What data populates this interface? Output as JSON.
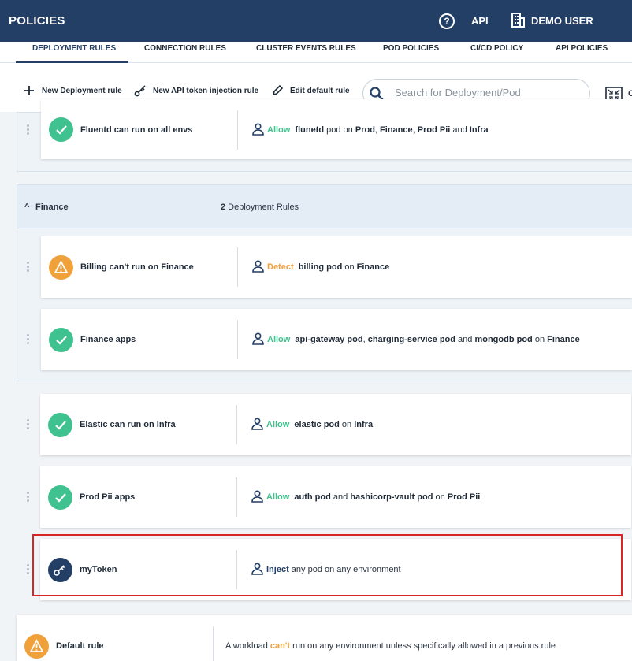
{
  "header": {
    "title": "POLICIES",
    "help_label": "?",
    "api_label": "API",
    "user_label": "DEMO USER"
  },
  "tabs": [
    {
      "label": "DEPLOYMENT RULES",
      "active": true
    },
    {
      "label": "CONNECTION RULES",
      "active": false
    },
    {
      "label": "CLUSTER EVENTS RULES",
      "active": false
    },
    {
      "label": "POD POLICIES",
      "active": false
    },
    {
      "label": "CI/CD POLICY",
      "active": false
    },
    {
      "label": "API POLICIES",
      "active": false
    }
  ],
  "toolbar": {
    "new_deployment_rule": "New Deployment rule",
    "new_api_token_rule": "New API token injection rule",
    "edit_default_rule": "Edit default rule",
    "search_placeholder": "Search for Deployment/Pod",
    "truncated_label": "C"
  },
  "groups": {
    "finance": {
      "name": "Finance",
      "count": "2",
      "count_suffix": " Deployment Rules"
    }
  },
  "rules": {
    "fluentd": {
      "name": "Fluentd can run on all envs",
      "action": "Allow",
      "pod": "flunetd",
      "pod_word": " pod",
      "on": " on ",
      "env1": "Prod",
      "sep1": ", ",
      "env2": "Finance",
      "sep2": ", ",
      "env3": "Prod Pii",
      "and": " and ",
      "env4": "Infra"
    },
    "billing": {
      "name": "Billing can't run on Finance",
      "action": "Detect",
      "pod": "billing",
      "pod_word": " pod",
      "on": " on ",
      "env1": "Finance"
    },
    "finance_apps": {
      "name": "Finance apps",
      "action": "Allow",
      "pod1": "api-gateway pod",
      "sep1": ", ",
      "pod2": "charging-service pod",
      "and": " and ",
      "pod3": "mongodb pod",
      "on": " on ",
      "env1": "Finance"
    },
    "elastic": {
      "name": "Elastic can run on Infra",
      "action": "Allow",
      "pod": "elastic",
      "pod_word": " pod",
      "on": " on ",
      "env1": "Infra"
    },
    "prodpii": {
      "name": "Prod Pii apps",
      "action": "Allow",
      "pod1": "auth pod",
      "and": " and ",
      "pod2": "hashicorp-vault pod",
      "on": " on ",
      "env1": "Prod Pii"
    },
    "mytoken": {
      "name": "myToken",
      "action": "Inject",
      "rest": " any pod on any environment"
    },
    "default": {
      "name": "Default rule",
      "pre": "A workload ",
      "cant": "can't",
      "post": " run on any environment unless specifically allowed in a previous rule"
    }
  },
  "colors": {
    "header_bg": "#243f66",
    "allow": "#3fc28f",
    "detect": "#f0a13a",
    "highlight": "#d62626"
  }
}
